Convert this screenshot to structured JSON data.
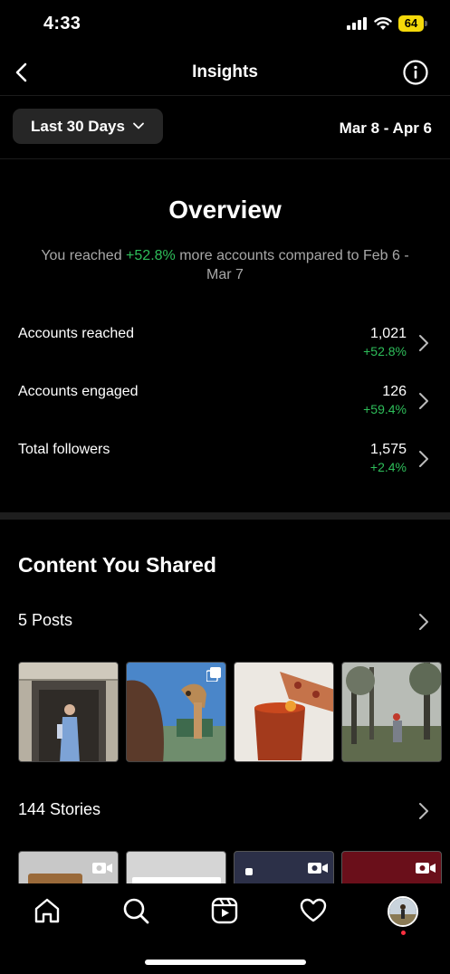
{
  "status_bar": {
    "time": "4:33",
    "battery": "64"
  },
  "header": {
    "title": "Insights"
  },
  "filter": {
    "range_label": "Last 30 Days",
    "date_range": "Mar 8 - Apr 6"
  },
  "overview": {
    "title": "Overview",
    "text_prefix": "You reached ",
    "text_highlight": "+52.8%",
    "text_suffix": " more accounts compared to Feb 6 - Mar 7",
    "metrics": [
      {
        "label": "Accounts reached",
        "value": "1,021",
        "change": "+52.8%"
      },
      {
        "label": "Accounts engaged",
        "value": "126",
        "change": "+59.4%"
      },
      {
        "label": "Total followers",
        "value": "1,575",
        "change": "+2.4%"
      }
    ]
  },
  "content": {
    "title": "Content You Shared",
    "posts_label": "5 Posts",
    "stories_label": "144 Stories"
  },
  "colors": {
    "accent_green": "#2ebe5a",
    "battery_yellow": "#f5d90a",
    "notification_red": "#ff3040"
  }
}
